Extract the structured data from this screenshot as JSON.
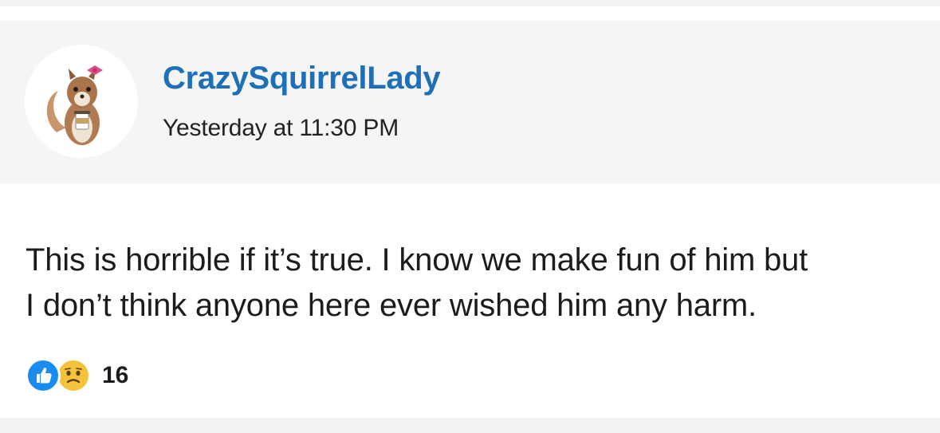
{
  "post": {
    "author": {
      "username": "CrazySquirrelLady",
      "avatar_icon": "squirrel-avatar",
      "name_color": "#1d6fb8"
    },
    "timestamp": "Yesterday at 11:30 PM",
    "body_lines": [
      "This is horrible if it’s true. I know we make fun of him but",
      "I don’t think anyone here ever wished him any harm."
    ],
    "reactions": {
      "icons": [
        "like-icon",
        "sad-icon"
      ],
      "count": "16",
      "like_color": "#1a8cf0",
      "sad_color": "#f5c33b"
    }
  }
}
